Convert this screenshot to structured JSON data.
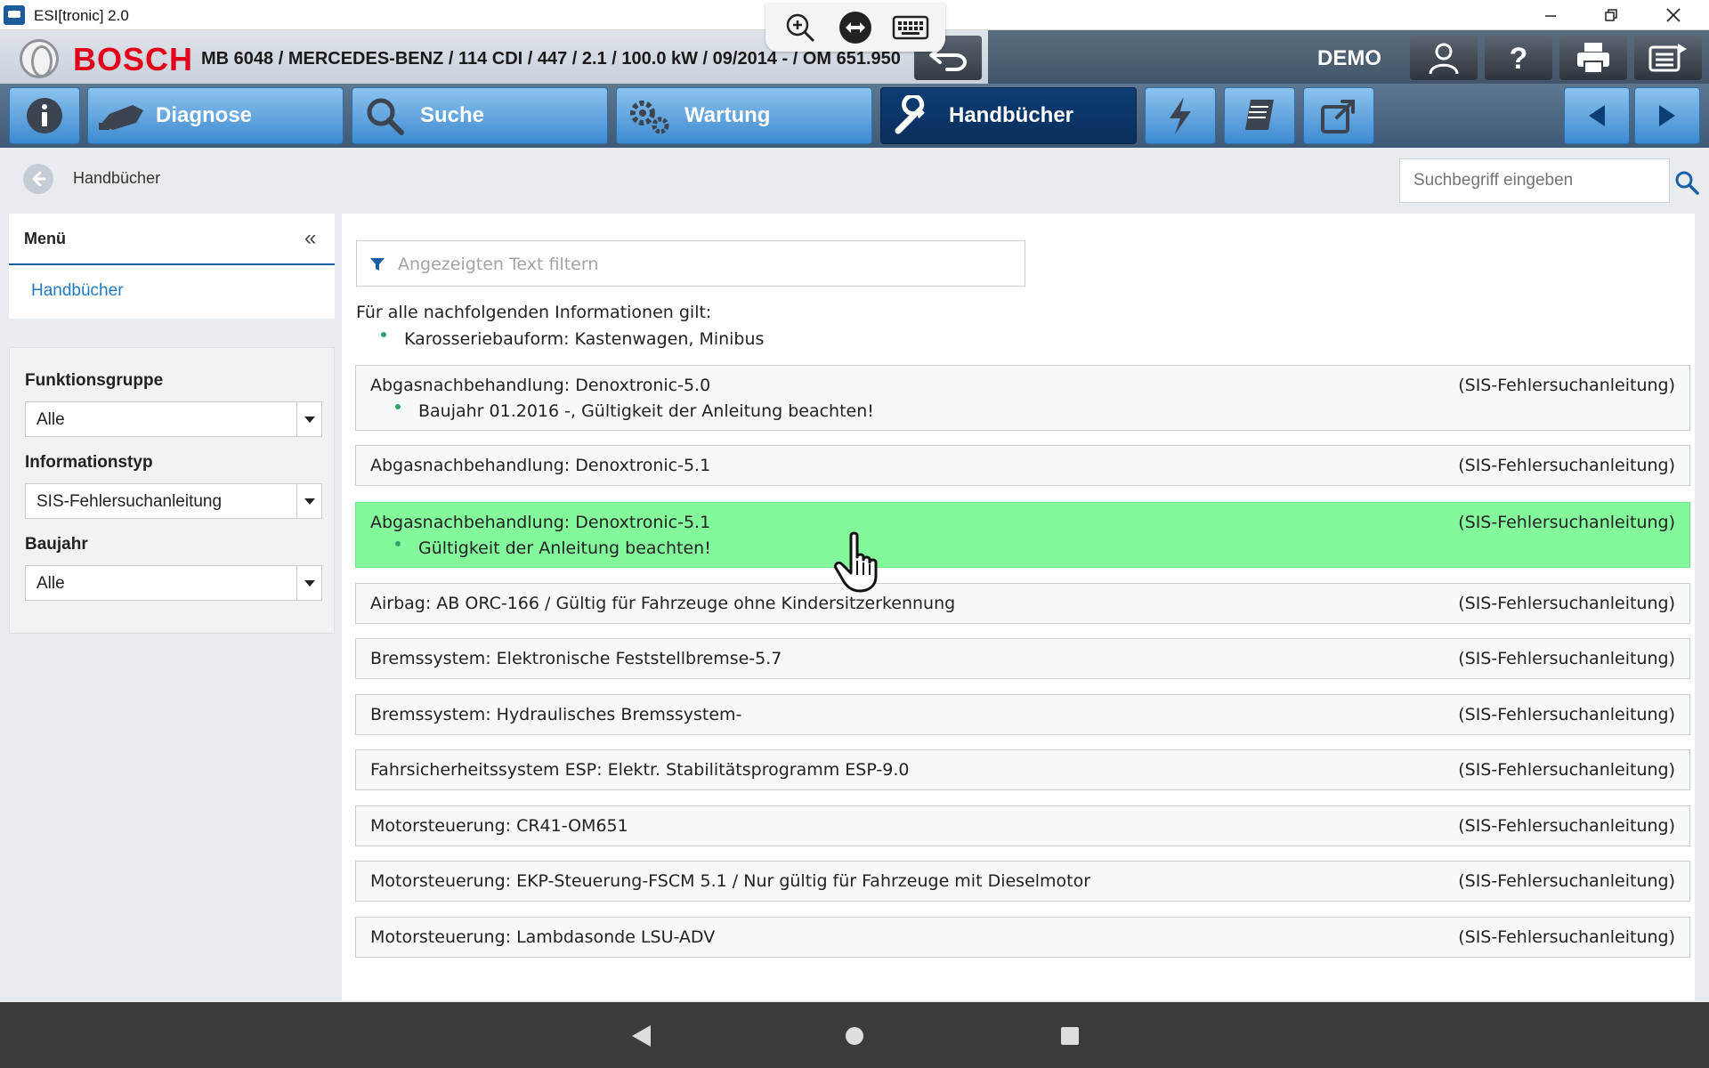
{
  "window": {
    "title": "ESI[tronic] 2.0",
    "controls": [
      "minimize",
      "restore",
      "close"
    ]
  },
  "header": {
    "brand": "BOSCH",
    "vehicle": "MB 6048 / MERCEDES-BENZ / 114 CDI / 447 / 2.1 / 100.0 kW / 09/2014 - / OM 651.950",
    "mode": "DEMO"
  },
  "nav": {
    "tabs": [
      {
        "label": "Diagnose"
      },
      {
        "label": "Suche"
      },
      {
        "label": "Wartung"
      },
      {
        "label": "Handbücher"
      }
    ],
    "active_tab": "Handbücher"
  },
  "breadcrumb": {
    "current": "Handbücher"
  },
  "search": {
    "placeholder": "Suchbegriff eingeben"
  },
  "sidebar": {
    "menu_title": "Menü",
    "collapse_glyph": "«",
    "menu_item": "Handbücher",
    "filters": [
      {
        "label": "Funktionsgruppe",
        "value": "Alle"
      },
      {
        "label": "Informationstyp",
        "value": "SIS-Fehlersuchanleitung"
      },
      {
        "label": "Baujahr",
        "value": "Alle"
      }
    ]
  },
  "main": {
    "filter_placeholder": "Angezeigten Text filtern",
    "intro": "Für alle nachfolgenden Informationen gilt:",
    "intro_bullet": "Karosseriebauform: Kastenwagen, Minibus",
    "rows": [
      {
        "title": "Abgasnachbehandlung: Denoxtronic-5.0",
        "type": "(SIS-Fehlersuchanleitung)",
        "note": "Baujahr 01.2016 -, Gültigkeit der Anleitung beachten!",
        "selected": false
      },
      {
        "title": "Abgasnachbehandlung: Denoxtronic-5.1",
        "type": "(SIS-Fehlersuchanleitung)",
        "note": "",
        "selected": false
      },
      {
        "title": "Abgasnachbehandlung: Denoxtronic-5.1",
        "type": "(SIS-Fehlersuchanleitung)",
        "note": "Gültigkeit der Anleitung beachten!",
        "selected": true
      },
      {
        "title": "Airbag: AB ORC-166 / Gültig für Fahrzeuge ohne Kindersitzerkennung",
        "type": "(SIS-Fehlersuchanleitung)",
        "note": "",
        "selected": false
      },
      {
        "title": "Bremssystem: Elektronische Feststellbremse-5.7",
        "type": "(SIS-Fehlersuchanleitung)",
        "note": "",
        "selected": false
      },
      {
        "title": "Bremssystem: Hydraulisches Bremssystem-",
        "type": "(SIS-Fehlersuchanleitung)",
        "note": "",
        "selected": false
      },
      {
        "title": "Fahrsicherheitssystem ESP: Elektr. Stabilitätsprogramm ESP-9.0",
        "type": "(SIS-Fehlersuchanleitung)",
        "note": "",
        "selected": false
      },
      {
        "title": "Motorsteuerung: CR41-OM651",
        "type": "(SIS-Fehlersuchanleitung)",
        "note": "",
        "selected": false
      },
      {
        "title": "Motorsteuerung: EKP-Steuerung-FSCM 5.1 / Nur gültig für Fahrzeuge mit Dieselmotor",
        "type": "(SIS-Fehlersuchanleitung)",
        "note": "",
        "selected": false
      },
      {
        "title": "Motorsteuerung: Lambdasonde LSU-ADV",
        "type": "(SIS-Fehlersuchanleitung)",
        "note": "",
        "selected": false
      }
    ]
  },
  "colors": {
    "brand_red": "#e2001a",
    "selected_row": "#84f99b",
    "link_blue": "#1f7bc4",
    "active_tab": "#0c3d74"
  }
}
